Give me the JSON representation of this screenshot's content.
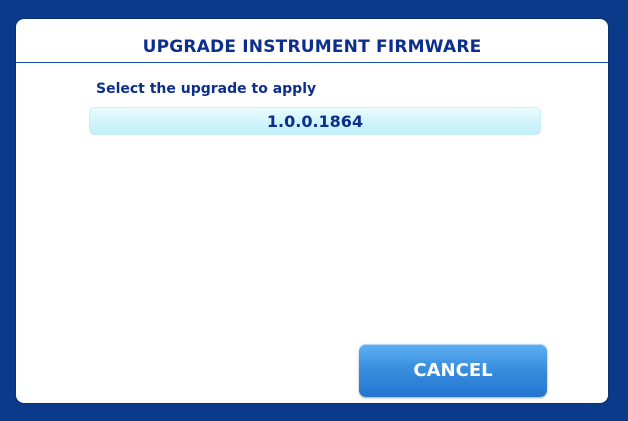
{
  "dialog": {
    "title": "UPGRADE INSTRUMENT FIRMWARE",
    "prompt": "Select the upgrade to apply",
    "options": [
      {
        "label": "1.0.0.1864"
      }
    ],
    "cancel_label": "CANCEL"
  },
  "colors": {
    "frame": "#0b3a8a",
    "text": "#0d2f8c",
    "option_bg": "#d0f4fb",
    "button": "#3a8fe0"
  }
}
